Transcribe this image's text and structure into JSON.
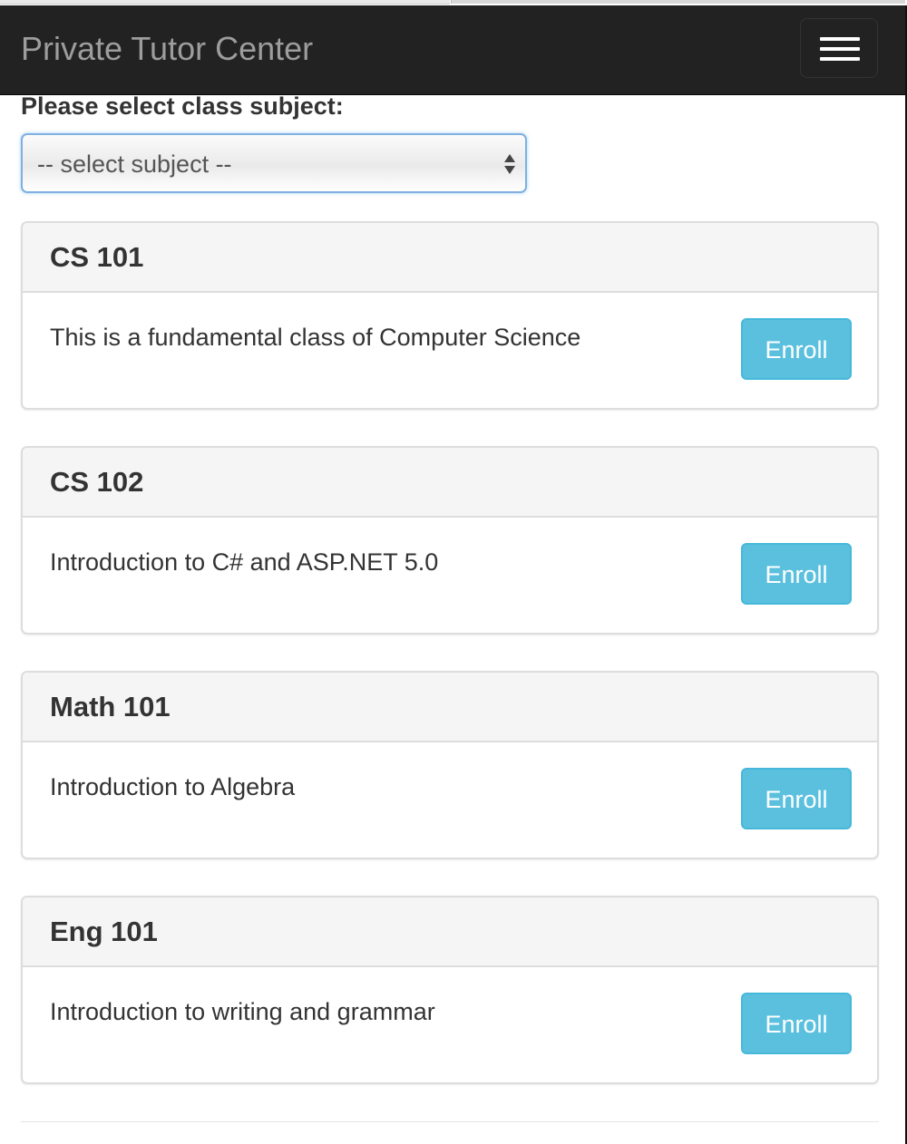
{
  "navbar": {
    "brand": "Private Tutor Center",
    "menu_icon": "hamburger-menu-icon"
  },
  "filter": {
    "label": "Please select class subject:",
    "select_value": "-- select subject --",
    "arrow_icon": "select-updown-arrows-icon"
  },
  "classes": [
    {
      "title": "CS 101",
      "description": "This is a fundamental class of Computer Science",
      "button": "Enroll"
    },
    {
      "title": "CS 102",
      "description": "Introduction to C# and ASP.NET 5.0",
      "button": "Enroll"
    },
    {
      "title": "Math 101",
      "description": "Introduction to Algebra",
      "button": "Enroll"
    },
    {
      "title": "Eng 101",
      "description": "Introduction to writing and grammar",
      "button": "Enroll"
    }
  ],
  "colors": {
    "navbar_bg": "#222222",
    "brand_text": "#9d9d9d",
    "info_button": "#5bc0de",
    "panel_heading": "#f5f5f5"
  }
}
